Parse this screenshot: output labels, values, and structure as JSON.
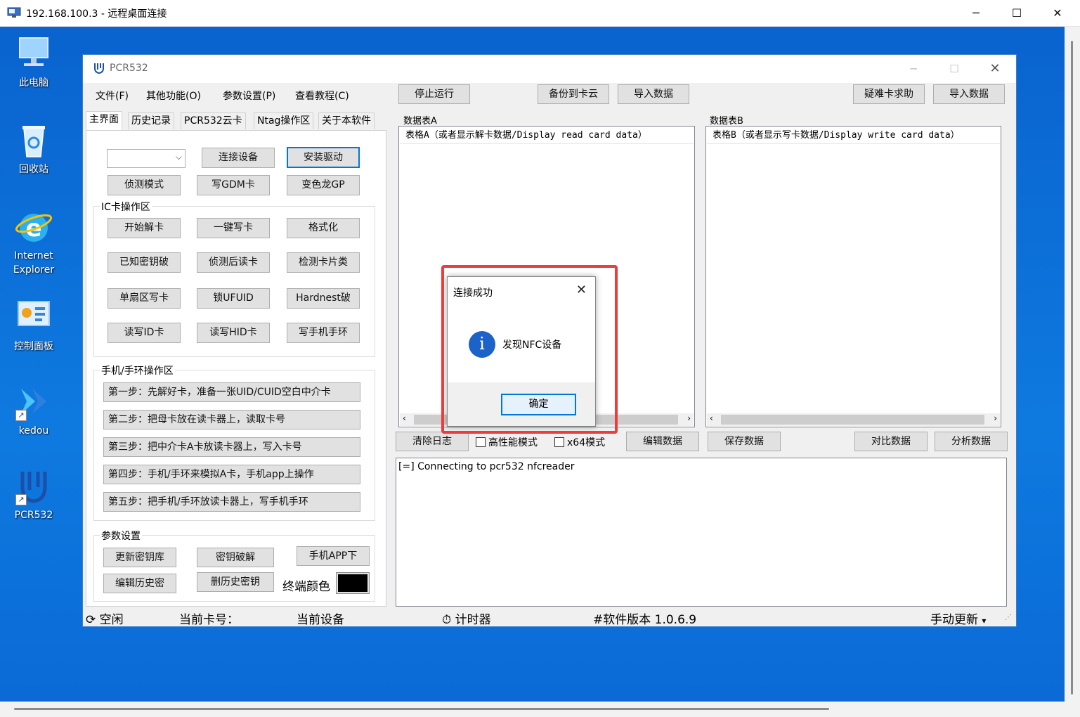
{
  "rdp": {
    "title": "192.168.100.3 - 远程桌面连接",
    "min": "─",
    "max": "☐",
    "close": "✕"
  },
  "desktop_icons": [
    {
      "label": "此电脑"
    },
    {
      "label": "回收站"
    },
    {
      "label": "Internet Explorer"
    },
    {
      "label": "控制面板"
    },
    {
      "label": "kedou"
    },
    {
      "label": "PCR532"
    }
  ],
  "app": {
    "title": "PCR532",
    "menu": [
      "文件(F)",
      "其他功能(O)",
      "参数设置(P)",
      "查看教程(C)"
    ],
    "toolbar": {
      "stop": "停止运行",
      "backup_cloud": "备份到卡云",
      "import_a": "导入数据",
      "help_hard": "疑难卡求助",
      "import_b": "导入数据"
    },
    "tabs": [
      "主界面",
      "历史记录",
      "PCR532云卡",
      "Ntag操作区",
      "关于本软件"
    ],
    "top_buttons": {
      "connect": "连接设备",
      "install_driver": "安装驱动",
      "detect_mode": "侦测模式",
      "write_gdm": "写GDM卡",
      "chameleon": "变色龙GP"
    },
    "ic_group": {
      "title": "IC卡操作区",
      "buttons": [
        "开始解卡",
        "一键写卡",
        "格式化",
        "已知密钥破",
        "侦测后读卡",
        "检测卡片类",
        "单扇区写卡",
        "锁UFUID",
        "Hardnest破",
        "读写ID卡",
        "读写HID卡",
        "写手机手环"
      ]
    },
    "phone_group": {
      "title": "手机/手环操作区",
      "steps": [
        "第一步：先解好卡，准备一张UID/CUID空白中介卡",
        "第二步：把母卡放在读卡器上，读取卡号",
        "第三步：把中介卡A卡放读卡器上，写入卡号",
        "第四步：手机/手环来模拟A卡，手机app上操作",
        "第五步：把手机/手环放读卡器上，写手机手环"
      ]
    },
    "param_group": {
      "title": "参数设置",
      "update_keys": "更新密钥库",
      "key_crack": "密钥破解",
      "phone_app": "手机APP下",
      "edit_history": "编辑历史密",
      "delete_history": "删历史密钥",
      "terminal_color_label": "终端颜色",
      "terminal_color": "#000000"
    },
    "table_a": {
      "label": "数据表A",
      "header": "表格A（或者显示解卡数据/Display read card data）"
    },
    "table_b": {
      "label": "数据表B",
      "header": "表格B（或者显示写卡数据/Display write card data）"
    },
    "bottom_bar": {
      "clear_log": "清除日志",
      "high_perf": "高性能模式",
      "x64": "x64模式",
      "edit_data": "编辑数据",
      "save_data": "保存数据",
      "compare_data": "对比数据",
      "analyze_data": "分析数据"
    },
    "log_text": "[=] Connecting to pcr532 nfcreader",
    "status": {
      "idle": "空闲",
      "card_no": "当前卡号：",
      "device": "当前设备",
      "timer": "计时器",
      "version": "#软件版本 1.0.6.9",
      "manual_update": "手动更新"
    }
  },
  "dialog": {
    "title": "连接成功",
    "message": "发现NFC设备",
    "ok": "确定",
    "close": "✕"
  },
  "colors": {
    "desktop": "#0a6fd6",
    "highlight": "#ec3c3c",
    "info_icon": "#1c62c9",
    "focus": "#0078d7"
  }
}
